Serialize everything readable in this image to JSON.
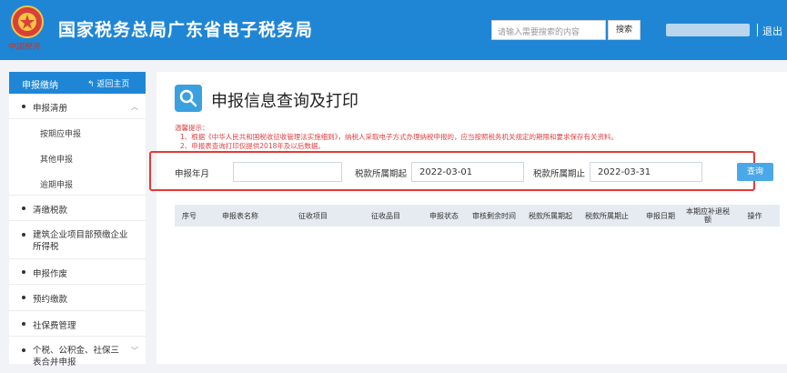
{
  "header": {
    "emblem_text": "中国税务",
    "title": "国家税务总局广东省电子税务局",
    "search_placeholder": "请输入需要搜索的内容",
    "search_button": "搜索",
    "separator": "|",
    "logout": "退出"
  },
  "sidebar": {
    "title": "申报缴纳",
    "home_link": "返回主页",
    "items": [
      {
        "label": "申报清册",
        "expanded": true,
        "children": [
          "按期应申报",
          "其他申报",
          "逾期申报"
        ]
      },
      {
        "label": "清缴税款"
      },
      {
        "label": "建筑企业项目部预缴企业所得税"
      },
      {
        "label": "申报作废"
      },
      {
        "label": "预约缴款"
      },
      {
        "label": "社保费管理"
      },
      {
        "label": "个税、公积金、社保三表合并申报"
      }
    ]
  },
  "main": {
    "title": "申报信息查询及打印",
    "tips_title": "温馨提示：",
    "tips": [
      "1、根据《中华人民共和国税收征收管理法实施细则》，纳税人采取电子方式办理纳税申报的，应当按照税务机关规定的期限和要求保存有关资料。",
      "2、申报表查询打印仅提供2018年及以后数据。"
    ],
    "form": {
      "period_label": "申报年月",
      "period_value": "",
      "start_label": "税款所属期起",
      "start_value": "2022-03-01",
      "end_label": "税款所属期止",
      "end_value": "2022-03-31",
      "query_button": "查询"
    },
    "table_headers": [
      "序号",
      "申报表名称",
      "征收项目",
      "征收品目",
      "申报状态",
      "审核剩余时间",
      "税款所属期起",
      "税款所属期止",
      "申报日期",
      "本期应补退税额",
      "操作"
    ]
  },
  "colors": {
    "header_blue": "#1f86d6",
    "highlight_red": "#e53935",
    "tips_red": "#e04040",
    "query_button": "#4aa7e8"
  }
}
